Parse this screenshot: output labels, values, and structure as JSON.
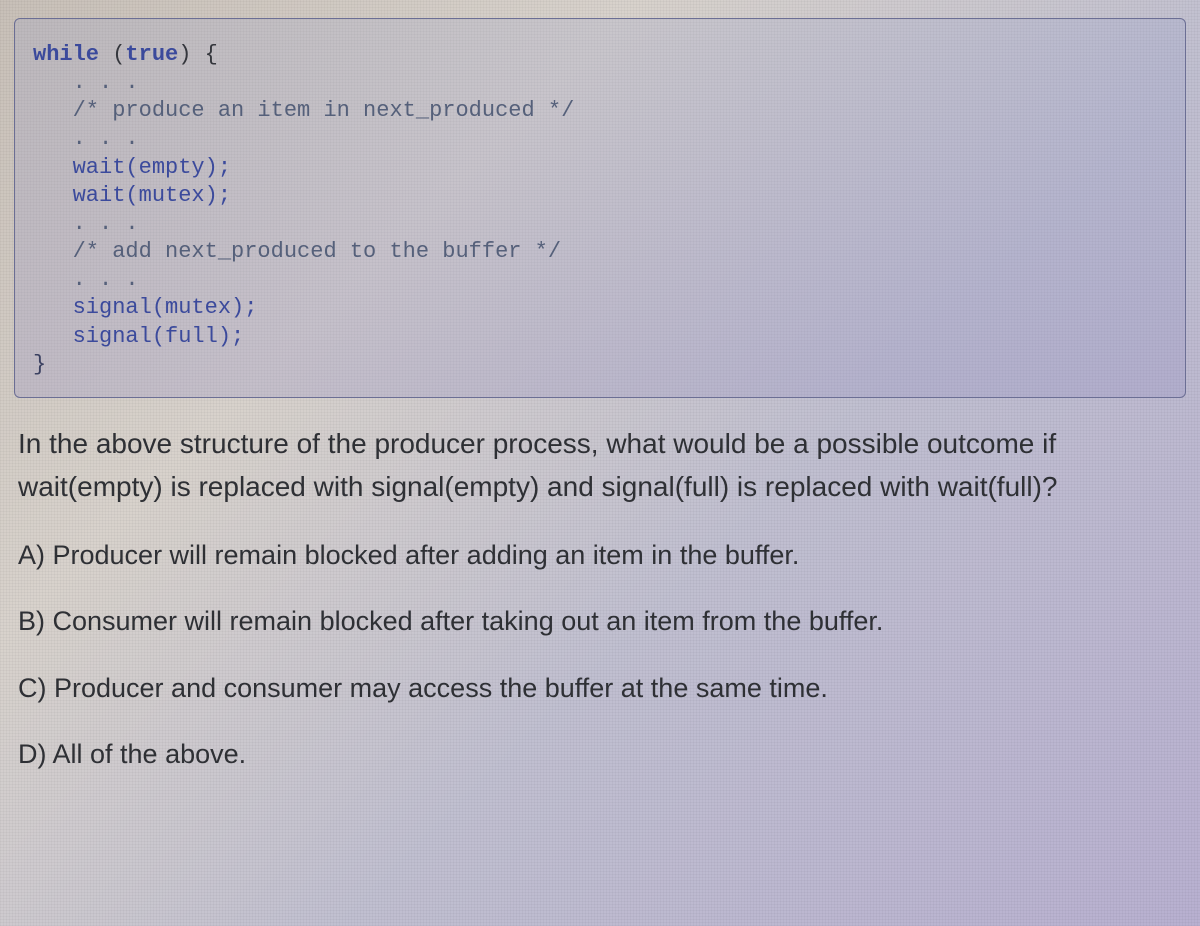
{
  "code": {
    "l1a": "while",
    "l1b": " (",
    "l1c": "true",
    "l1d": ") {",
    "l2": "   . . .",
    "l3": "   /* produce an item in next_produced */",
    "l4": "   . . .",
    "l5": "   wait(empty);",
    "l6": "   wait(mutex);",
    "l7": "   . . .",
    "l8": "   /* add next_produced to the buffer */",
    "l9": "   . . .",
    "l10": "   signal(mutex);",
    "l11": "   signal(full);",
    "l12": "}"
  },
  "question": "In the above structure of the producer process, what would be a possible outcome if wait(empty) is replaced with signal(empty) and signal(full) is replaced with wait(full)?",
  "choices": {
    "a": "A) Producer will remain blocked after adding an item in the buffer.",
    "b": "B) Consumer will remain blocked after taking out an item from the buffer.",
    "c": "C) Producer and consumer may access the buffer at the same time.",
    "d": "D) All of the above."
  }
}
